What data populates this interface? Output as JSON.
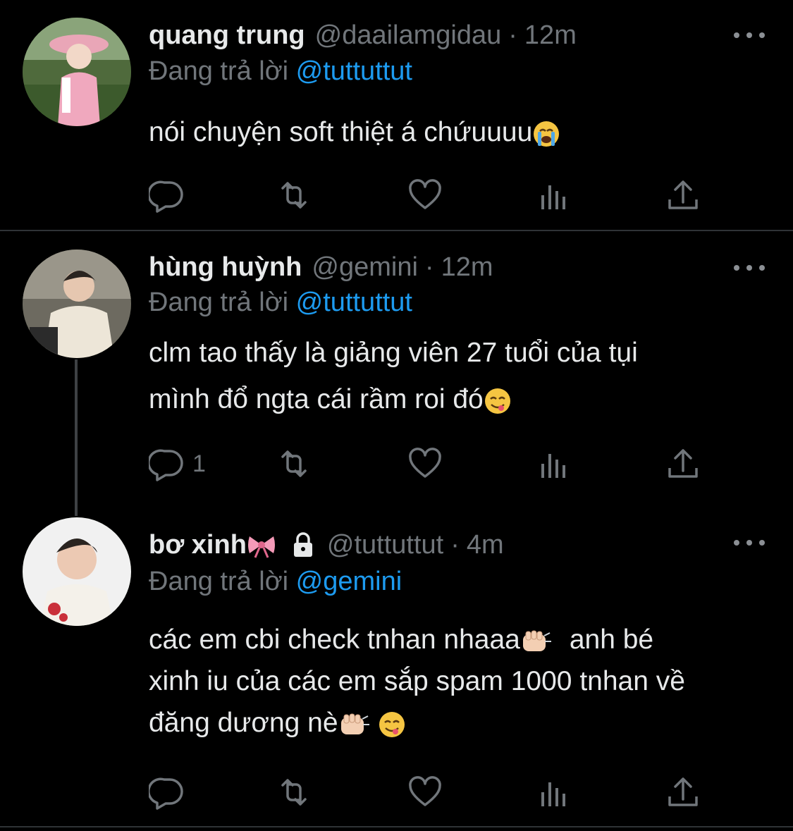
{
  "tweets": [
    {
      "name": "quang trung",
      "handle": "@daailamgidau",
      "time": "12m",
      "reply_prefix": "Đang trả lời",
      "reply_to": "@tuttuttut",
      "lines": [
        "nói chuyện soft thiệt á chứuuuu"
      ],
      "reply_count": ""
    },
    {
      "name": "hùng huỳnh",
      "handle": "@gemini",
      "time": "12m",
      "reply_prefix": "Đang trả lời",
      "reply_to": "@tuttuttut",
      "lines": [
        "clm tao thấy là giảng viên 27 tuổi của tụi",
        "mình đổ ngta cái rầm roi đó"
      ],
      "reply_count": "1"
    },
    {
      "name": "bơ xinh",
      "handle": "@tuttuttut",
      "time": "4m",
      "reply_prefix": "Đang trả lời",
      "reply_to": "@gemini",
      "lines": [
        "các em cbi check tnhan nhaaa",
        "anh bé",
        "xinh iu của các em sắp spam 1000 tnhan về",
        "đăng dương nè"
      ],
      "reply_count": ""
    }
  ],
  "separator": "·",
  "icons": {
    "reply": "reply-icon",
    "retweet": "retweet-icon",
    "like": "heart-icon",
    "views": "views-icon",
    "share": "share-icon",
    "more": "more-icon",
    "lock": "lock-icon"
  },
  "colors": {
    "background": "#000000",
    "text": "#e7e9ea",
    "secondary": "#71767b",
    "mention": "#1d9bf0",
    "divider": "#2f3336"
  }
}
